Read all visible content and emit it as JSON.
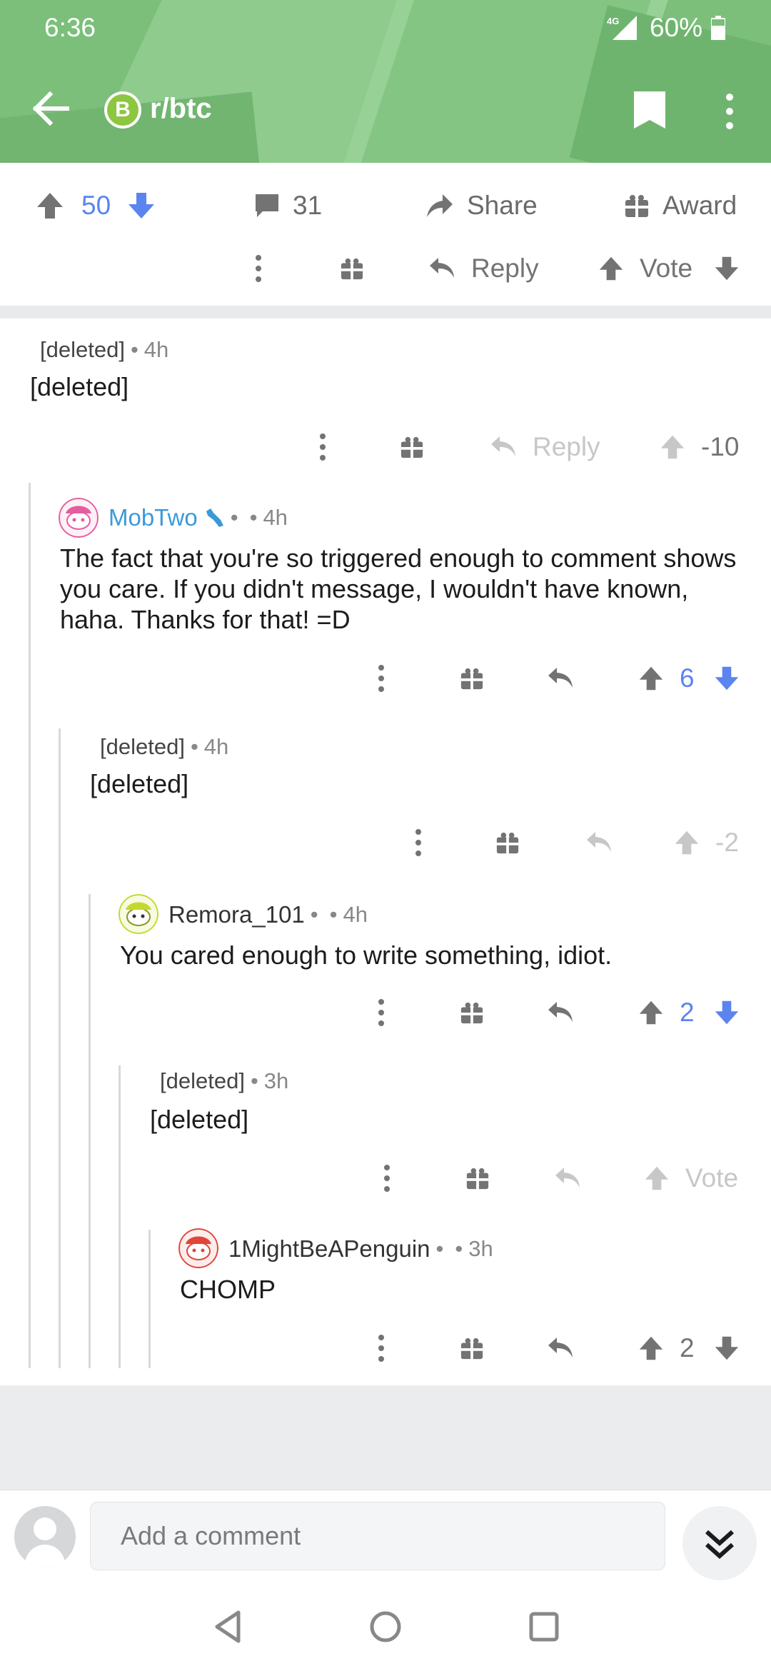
{
  "status_bar": {
    "time": "6:36",
    "network": "4G",
    "battery_pct": "60%"
  },
  "app_bar": {
    "subreddit_icon_letter": "B",
    "subreddit": "r/btc"
  },
  "post_actions": {
    "score": "50",
    "comments": "31",
    "share": "Share",
    "award": "Award"
  },
  "top_action_row": {
    "reply": "Reply",
    "vote": "Vote"
  },
  "comments": [
    {
      "author": "[deleted]",
      "time": "4h",
      "body": "[deleted]",
      "score": "-10",
      "reply_label": "Reply"
    },
    {
      "author": "MobTwo",
      "time": "4h",
      "body": "The fact that you're so triggered enough to comment shows you care. If you didn't message, I wouldn't have known, haha. Thanks for that! =D",
      "score": "6"
    },
    {
      "author": "[deleted]",
      "time": "4h",
      "body": "[deleted]",
      "score": "-2"
    },
    {
      "author": "Remora_101",
      "time": "4h",
      "body": "You cared enough to write something, idiot.",
      "score": "2"
    },
    {
      "author": "[deleted]",
      "time": "3h",
      "body": "[deleted]",
      "score": "Vote"
    },
    {
      "author": "1MightBeAPenguin",
      "time": "3h",
      "body": "CHOMP",
      "score": "2"
    }
  ],
  "dot": "•",
  "comment_input": {
    "placeholder": "Add a comment"
  },
  "colors": {
    "header_green": "#7bbf7a",
    "upvote_blue": "#5b84f1",
    "author_blue": "#3a9ad9",
    "icon_gray": "#737373"
  }
}
